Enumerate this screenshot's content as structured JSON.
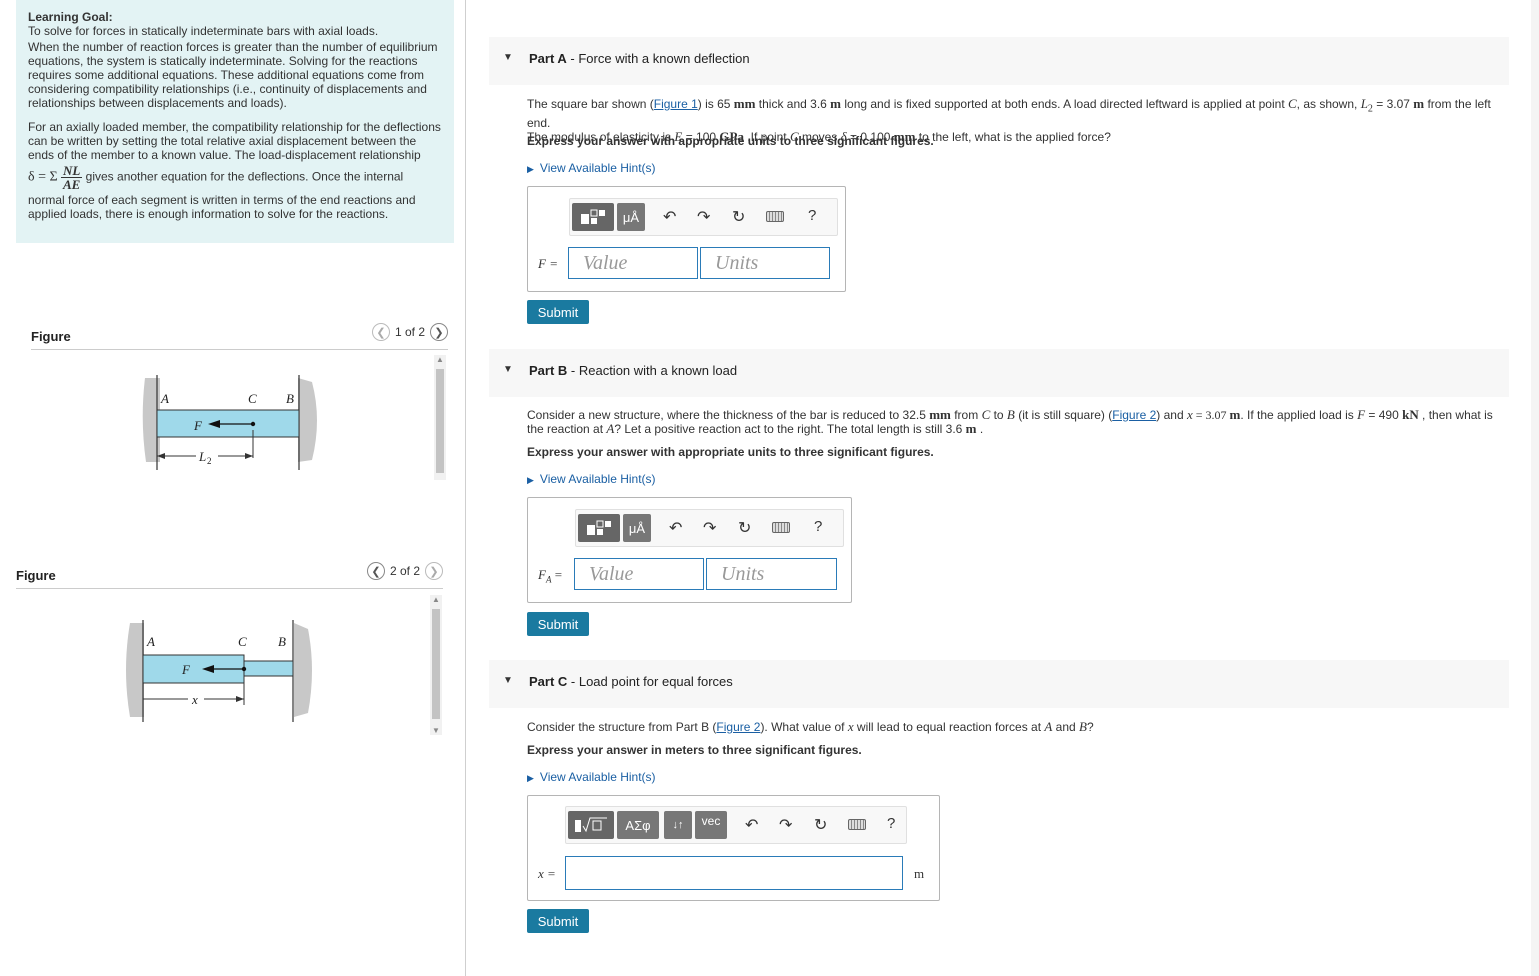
{
  "goal": {
    "title": "Learning Goal:",
    "subtitle": "To solve for forces in statically indeterminate bars with axial loads.",
    "p1": "When the number of reaction forces is greater than the number of equilibrium equations, the system is statically indeterminate. Solving for the reactions requires some additional equations. These additional equations come from considering compatibility relationships (i.e., continuity of displacements and relationships between displacements and loads).",
    "p2": "For an axially loaded member, the compatibility relationship for the deflections can be written by setting the total relative axial displacement between the ends of the member to a known value. The load-displacement relationship",
    "eq_lhs": "δ = Σ",
    "eq_num": "NL",
    "eq_den": "AE",
    "p3a": "gives another equation for the deflections. Once the internal",
    "p3b": "normal force of each segment is written in terms of the end reactions and applied loads, there is enough information to solve for the reactions."
  },
  "figure1": {
    "label": "Figure",
    "counter": "1 of 2",
    "lab_A": "A",
    "lab_C": "C",
    "lab_B": "B",
    "lab_F": "F",
    "lab_L": "L",
    "lab_L_sub": "2"
  },
  "figure2": {
    "label": "Figure",
    "counter": "2 of 2",
    "lab_A": "A",
    "lab_C": "C",
    "lab_B": "B",
    "lab_F": "F",
    "lab_x": "x"
  },
  "toolbar": {
    "mu": "μÅ",
    "greek": "ΑΣφ",
    "arrows": "↓↑",
    "vec": "vec",
    "undo": "↶",
    "redo": "↷",
    "reset": "↻",
    "help": "?"
  },
  "partA": {
    "letter": "Part A",
    "title": " - Force with a known deflection",
    "t1": "The square bar shown (",
    "link": "Figure 1",
    "t2": ") is 65 ",
    "u_mm": "mm",
    "t3": " thick and 3.6 ",
    "u_m": "m",
    "t4": " long and is fixed supported at both ends. A load directed leftward is applied at point ",
    "var_C": "C",
    "t5": ", as shown, ",
    "var_L": "L",
    "sub_2": "2",
    "t6": " = 3.07 ",
    "t7": " from the left end.",
    "t8": "The modulus of elasticity is ",
    "var_E": "E",
    "t9": " = 100 ",
    "u_GPa": "GPa",
    "t10": " .If point ",
    "t11": " moves ",
    "var_delta": "δ",
    "t12": " = 0.100 ",
    "t13": " to the left, what is the applied force?",
    "express": "Express your answer with appropriate units to three significant figures.",
    "hint": "View Available Hint(s)",
    "field_label": "F =",
    "value_placeholder": "Value",
    "units_placeholder": "Units",
    "submit": "Submit"
  },
  "partB": {
    "letter": "Part B",
    "title": " - Reaction with a known load",
    "t1": "Consider a new structure, where the thickness of the bar is reduced to 32.5 ",
    "u_mm": "mm",
    "t2": " from ",
    "var_C": "C",
    "t3": " to ",
    "var_B": "B",
    "t4": " (it is still square) (",
    "link": "Figure 2",
    "t5": ") and ",
    "var_x": "x",
    "t6": " = 3.07 ",
    "u_m": "m",
    "t7": ". If the applied load is ",
    "var_F": "F",
    "t8": " = 490 ",
    "u_kN": "kN",
    "t9": " , then what is",
    "t10": "the reaction at ",
    "var_A": "A",
    "t11": "? Let a positive reaction act to the right. The total length is still 3.6 ",
    "t12": " .",
    "express": "Express your answer with appropriate units to three significant figures.",
    "hint": "View Available Hint(s)",
    "field_label": "F",
    "field_sub": "A",
    "field_eq": " =",
    "value_placeholder": "Value",
    "units_placeholder": "Units",
    "submit": "Submit"
  },
  "partC": {
    "letter": "Part C",
    "title": " - Load point for equal forces",
    "t1": "Consider the structure from Part B (",
    "link": "Figure 2",
    "t2": "). What value of ",
    "var_x": "x",
    "t3": " will lead to equal reaction forces at ",
    "var_A": "A",
    "t4": " and ",
    "var_B": "B",
    "t5": "?",
    "express": "Express your answer in meters to three significant figures.",
    "hint": "View Available Hint(s)",
    "field_label": "x =",
    "unit": "m",
    "submit": "Submit"
  }
}
